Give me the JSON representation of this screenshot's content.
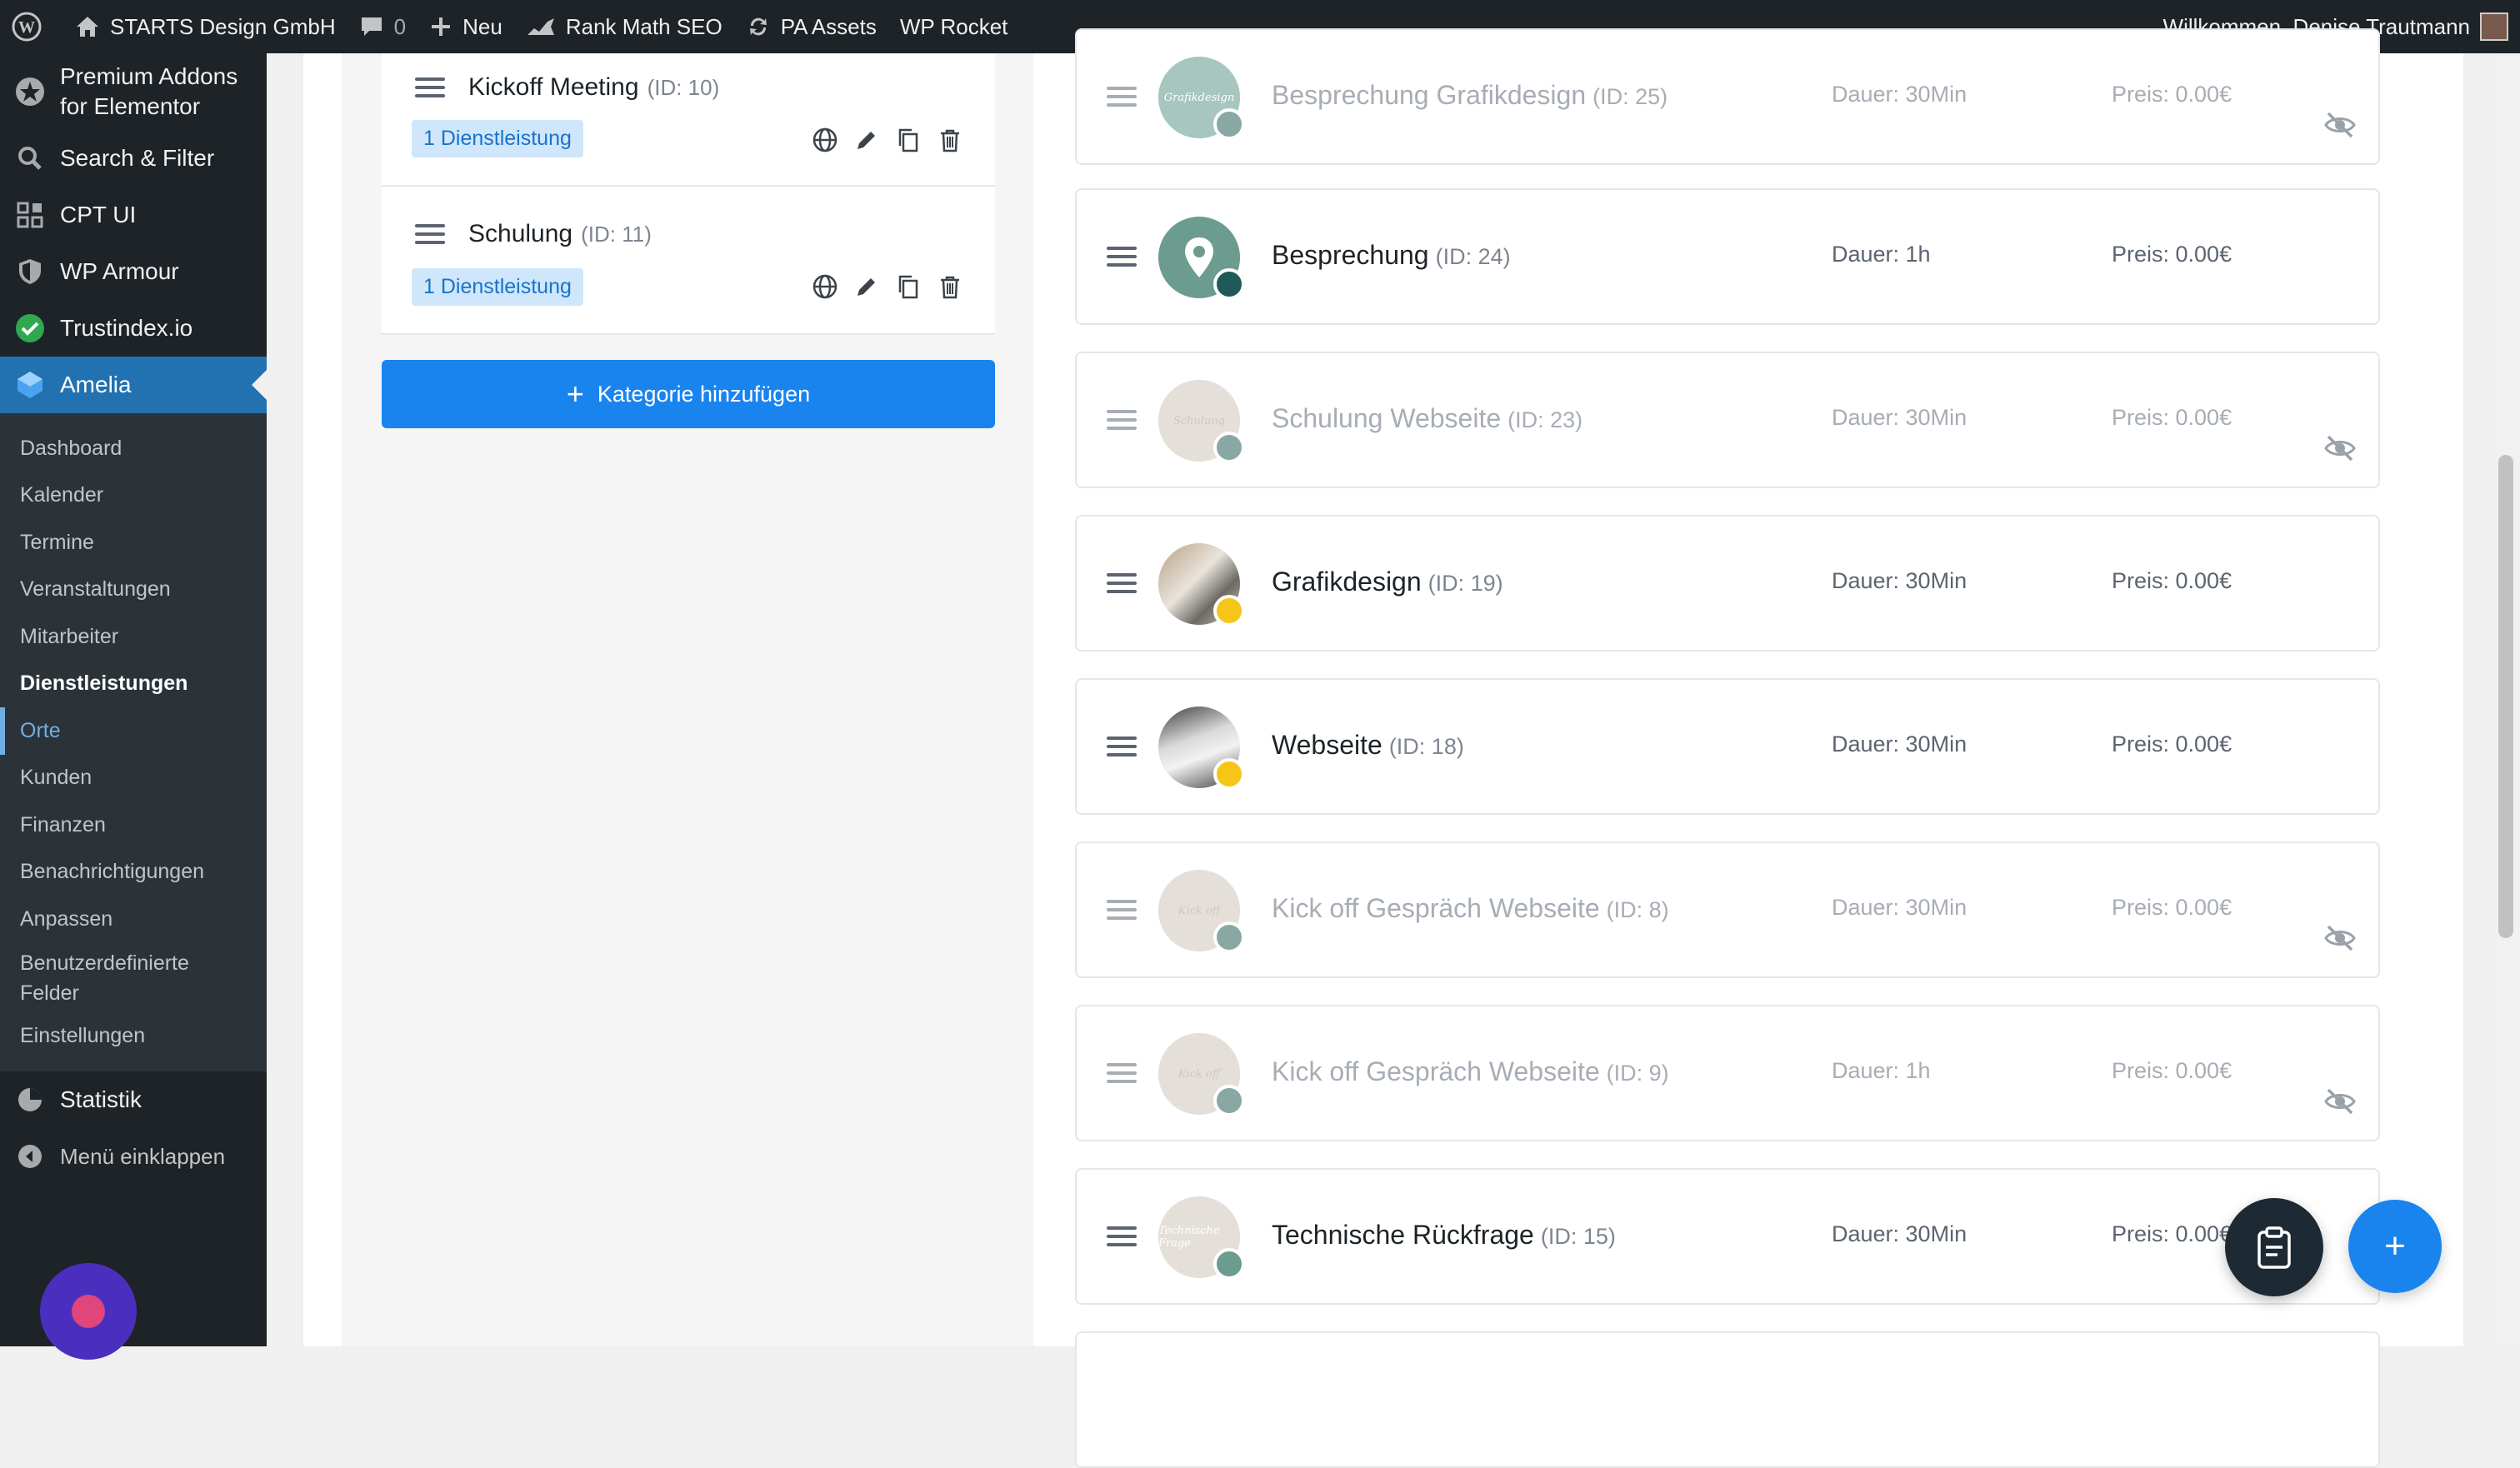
{
  "adminbar": {
    "site_name": "STARTS Design GmbH",
    "comments_count": "0",
    "new_label": "Neu",
    "rank_math": "Rank Math SEO",
    "pa_assets": "PA Assets",
    "wp_rocket": "WP Rocket",
    "greeting": "Willkommen, Denise Trautmann"
  },
  "sidebar": {
    "premium_addons": "Premium Addons for Elementor",
    "search_filter": "Search & Filter",
    "cpt_ui": "CPT UI",
    "wp_armour": "WP Armour",
    "trustindex": "Trustindex.io",
    "amelia": "Amelia",
    "submenu": [
      "Dashboard",
      "Kalender",
      "Termine",
      "Veranstaltungen",
      "Mitarbeiter",
      "Dienstleistungen",
      "Orte",
      "Kunden",
      "Finanzen",
      "Benachrichtigungen",
      "Anpassen",
      "Benutzerdefinierte Felder",
      "Einstellungen"
    ],
    "statistik": "Statistik",
    "collapse": "Menü einklappen"
  },
  "categories": [
    {
      "name": "Kickoff Meeting",
      "id": "(ID: 10)",
      "badge": "1 Dienstleistung"
    },
    {
      "name": "Schulung",
      "id": "(ID: 11)",
      "badge": "1 Dienstleistung"
    }
  ],
  "add_category": "Kategorie hinzufügen",
  "services": [
    {
      "name": "Besprechung Grafikdesign",
      "id": "(ID: 25)",
      "duration": "Dauer: 30Min",
      "price": "Preis: 0.00€",
      "thumb_text": "Grafikdesign"
    },
    {
      "name": "Besprechung",
      "id": "(ID: 24)",
      "duration": "Dauer: 1h",
      "price": "Preis: 0.00€"
    },
    {
      "name": "Schulung Webseite",
      "id": "(ID: 23)",
      "duration": "Dauer: 30Min",
      "price": "Preis: 0.00€",
      "thumb_text": "Schulung"
    },
    {
      "name": "Grafikdesign",
      "id": "(ID: 19)",
      "duration": "Dauer: 30Min",
      "price": "Preis: 0.00€"
    },
    {
      "name": "Webseite",
      "id": "(ID: 18)",
      "duration": "Dauer: 30Min",
      "price": "Preis: 0.00€"
    },
    {
      "name": "Kick off Gespräch Webseite",
      "id": "(ID: 8)",
      "duration": "Dauer: 30Min",
      "price": "Preis: 0.00€",
      "thumb_text": "Kick off"
    },
    {
      "name": "Kick off Gespräch Webseite",
      "id": "(ID: 9)",
      "duration": "Dauer: 1h",
      "price": "Preis: 0.00€",
      "thumb_text": "Kick off"
    },
    {
      "name": "Technische Rückfrage",
      "id": "(ID: 15)",
      "duration": "Dauer: 30Min",
      "price": "Preis: 0.00€",
      "thumb_text": "Technische Frage"
    }
  ],
  "colors": {
    "accent": "#1a84ee",
    "wp_active": "#2271b1",
    "status_hidden": "#8aa8a3",
    "status_teal": "#1f5a58",
    "status_yellow": "#f5c518"
  }
}
